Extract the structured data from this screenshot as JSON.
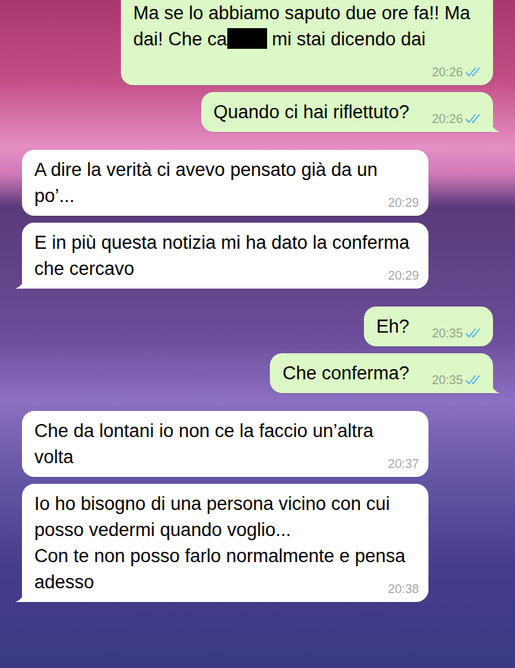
{
  "messages": [
    {
      "kind": "outgoing",
      "parts": [
        {
          "kind": "text",
          "text": "Ma se lo abbiamo saputo due ore fa!! Ma dai! Che ca"
        },
        {
          "kind": "redacted"
        },
        {
          "kind": "text",
          "text": " mi stai dicendo dai"
        }
      ],
      "time": "20:26",
      "read": true,
      "tail": false
    },
    {
      "kind": "outgoing",
      "parts": [
        {
          "kind": "text",
          "text": "Quando ci hai riflettuto?"
        }
      ],
      "time": "20:26",
      "read": true,
      "tail": true
    },
    {
      "kind": "incoming",
      "parts": [
        {
          "kind": "text",
          "text": "A dire la verità ci avevo pensato già da un po’..."
        }
      ],
      "time": "20:29",
      "tail": false
    },
    {
      "kind": "incoming",
      "parts": [
        {
          "kind": "text",
          "text": "E in più questa notizia mi ha dato la conferma che cercavo"
        }
      ],
      "time": "20:29",
      "tail": true
    },
    {
      "kind": "outgoing",
      "parts": [
        {
          "kind": "text",
          "text": "Eh?"
        }
      ],
      "time": "20:35",
      "read": true,
      "tail": false
    },
    {
      "kind": "outgoing",
      "parts": [
        {
          "kind": "text",
          "text": "Che conferma?"
        }
      ],
      "time": "20:35",
      "read": true,
      "tail": true
    },
    {
      "kind": "incoming",
      "parts": [
        {
          "kind": "text",
          "text": "Che da lontani io non ce la faccio un’altra volta"
        }
      ],
      "time": "20:37",
      "tail": false
    },
    {
      "kind": "incoming",
      "parts": [
        {
          "kind": "text",
          "text": "Io ho bisogno di una persona vicino con cui posso vedermi quando voglio...\nCon te non posso farlo normalmente e pensa adesso"
        }
      ],
      "time": "20:38",
      "tail": true
    }
  ]
}
